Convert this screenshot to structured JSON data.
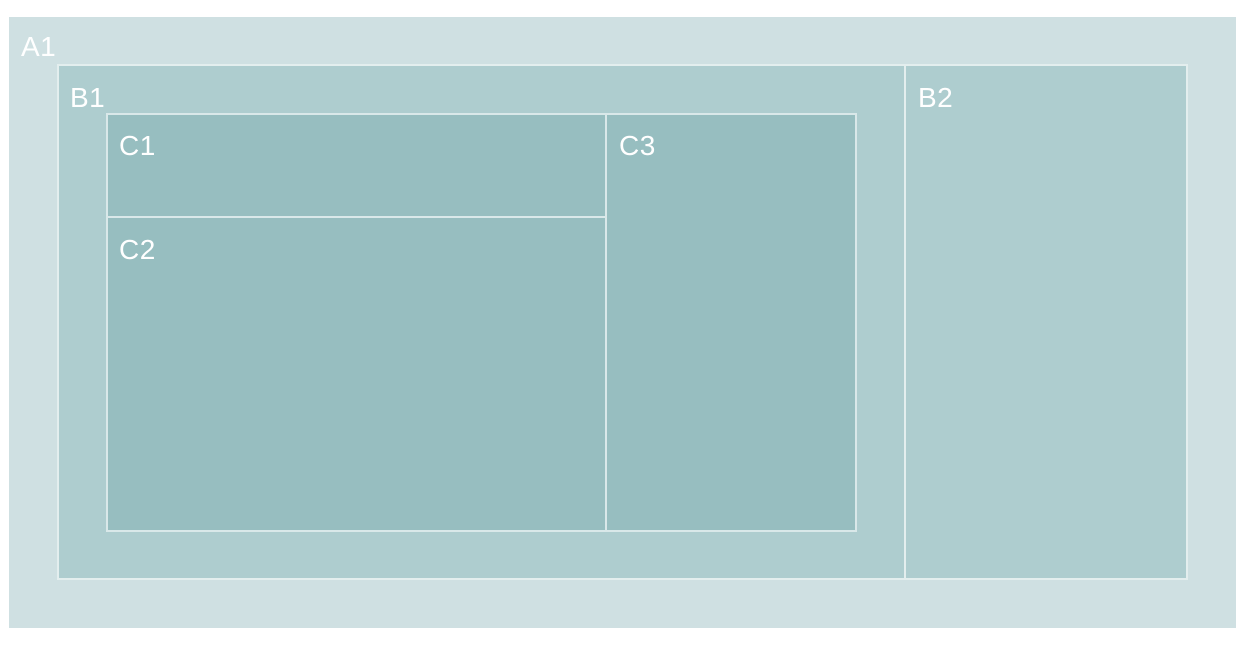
{
  "labels": {
    "a1": "A1",
    "b1": "B1",
    "b2": "B2",
    "c1": "C1",
    "c2": "C2",
    "c3": "C3"
  },
  "colors": {
    "level_a": "#cfe0e2",
    "level_b": "#aecdcf",
    "level_c": "#97bec0",
    "border": "#e3eeee",
    "label_text": "#ffffff"
  }
}
